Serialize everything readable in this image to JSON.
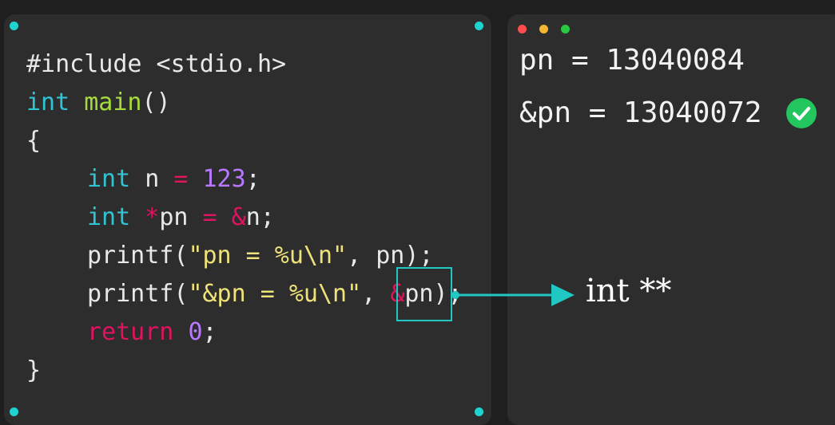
{
  "code_lines": [
    {
      "tokens": [
        {
          "t": "#include <stdio.h>",
          "c": "plain"
        }
      ]
    },
    {
      "tokens": [
        {
          "t": "int",
          "c": "kw"
        },
        {
          "t": " ",
          "c": "plain"
        },
        {
          "t": "main",
          "c": "fn"
        },
        {
          "t": "()",
          "c": "plain"
        }
      ]
    },
    {
      "tokens": [
        {
          "t": "{",
          "c": "plain"
        }
      ]
    },
    {
      "indent": true,
      "tokens": [
        {
          "t": "int",
          "c": "kw"
        },
        {
          "t": " n ",
          "c": "plain"
        },
        {
          "t": "=",
          "c": "op"
        },
        {
          "t": " ",
          "c": "plain"
        },
        {
          "t": "123",
          "c": "num"
        },
        {
          "t": ";",
          "c": "plain"
        }
      ]
    },
    {
      "indent": true,
      "tokens": [
        {
          "t": "int",
          "c": "kw"
        },
        {
          "t": " ",
          "c": "plain"
        },
        {
          "t": "*",
          "c": "op"
        },
        {
          "t": "pn ",
          "c": "plain"
        },
        {
          "t": "=",
          "c": "op"
        },
        {
          "t": " ",
          "c": "plain"
        },
        {
          "t": "&",
          "c": "op"
        },
        {
          "t": "n;",
          "c": "plain"
        }
      ]
    },
    {
      "indent": true,
      "tokens": [
        {
          "t": "printf(",
          "c": "plain"
        },
        {
          "t": "\"pn = %u\\n\"",
          "c": "str"
        },
        {
          "t": ", pn);",
          "c": "plain"
        }
      ]
    },
    {
      "indent": true,
      "tokens": [
        {
          "t": "printf(",
          "c": "plain"
        },
        {
          "t": "\"&pn = %u\\n\"",
          "c": "str"
        },
        {
          "t": ", ",
          "c": "plain"
        },
        {
          "t": "&",
          "c": "op"
        },
        {
          "t": "pn);",
          "c": "plain"
        }
      ]
    },
    {
      "indent": true,
      "tokens": [
        {
          "t": "return",
          "c": "op"
        },
        {
          "t": " ",
          "c": "plain"
        },
        {
          "t": "0",
          "c": "num"
        },
        {
          "t": ";",
          "c": "plain"
        }
      ]
    },
    {
      "tokens": [
        {
          "t": "}",
          "c": "plain"
        }
      ]
    }
  ],
  "output": {
    "line1": "pn = 13040084",
    "line2": "&pn = 13040072"
  },
  "annotation": {
    "type_label": "int **"
  },
  "colors": {
    "keyword": "#2fc3d6",
    "function": "#a6db3e",
    "operator": "#e0135f",
    "number": "#b879ff",
    "string": "#efe27a",
    "accent": "#1fd3d0",
    "check": "#22c55e",
    "window_dot_red": "#ff4d4f",
    "window_dot_yellow": "#f5b52e",
    "window_dot_green": "#28c940"
  },
  "icons": [
    "check-circle-icon",
    "arrow-right-icon"
  ]
}
